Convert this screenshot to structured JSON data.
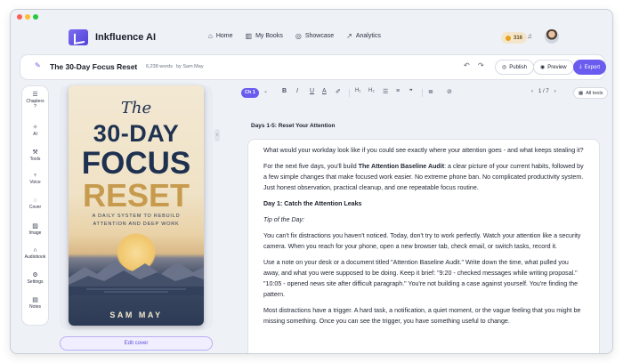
{
  "app": {
    "name": "Inkfluence AI",
    "nav": [
      {
        "label": "Home",
        "icon": "home-icon"
      },
      {
        "label": "My Books",
        "icon": "book-icon"
      },
      {
        "label": "Showcase",
        "icon": "globe-icon"
      },
      {
        "label": "Analytics",
        "icon": "chart-icon"
      }
    ],
    "credits": "316"
  },
  "header": {
    "title": "The 30-Day Focus Reset",
    "word_count": "6,238 words",
    "author": "by Sam May",
    "publish_label": "Publish",
    "preview_label": "Preview",
    "export_label": "Export"
  },
  "sidebar": {
    "items": [
      {
        "label": "Chapters",
        "icon": "list-icon"
      },
      {
        "label": "AI",
        "icon": "sparkle-icon"
      },
      {
        "label": "Tools",
        "icon": "wrench-icon"
      },
      {
        "label": "Voice",
        "icon": "microphone-icon"
      },
      {
        "label": "Cover",
        "icon": "palette-icon"
      },
      {
        "label": "Image",
        "icon": "image-icon"
      },
      {
        "label": "Audiobook",
        "icon": "headphones-icon"
      },
      {
        "label": "Settings",
        "icon": "gear-icon"
      },
      {
        "label": "Notes",
        "icon": "note-icon"
      }
    ],
    "help": "?"
  },
  "cover": {
    "line1": "The",
    "line2": "30-DAY",
    "line3": "FOCUS",
    "line4": "RESET",
    "subtitle1": "A DAILY SYSTEM TO REBUILD",
    "subtitle2": "ATTENTION AND DEEP WORK",
    "author": "SAM MAY",
    "edit_label": "Edit cover"
  },
  "editor": {
    "chapter_badge": "Ch 1",
    "page_indicator": "1 / 7",
    "all_tools_label": "All tools",
    "section_title": "Days 1-5: Reset Your Attention",
    "p1": "What would your workday look like if you could see exactly where your attention goes - and what keeps stealing it?",
    "p2_pre": "For the next five days, you'll build ",
    "p2_bold": "The Attention Baseline Audit",
    "p2_post": ": a clear picture of your current habits, followed by a few simple changes that make focused work easier. No extreme phone ban. No complicated productivity system. Just honest observation, practical cleanup, and one repeatable focus routine.",
    "h1": "Day 1: Catch the Attention Leaks",
    "tip": "Tip of the Day:",
    "p3": "You can't fix distractions you haven't noticed. Today, don't try to work perfectly. Watch your attention like a security camera. When you reach for your phone, open a new browser tab, check email, or switch tasks, record it.",
    "p4": "Use a note on your desk or a document titled \"Attention Baseline Audit.\" Write down the time, what pulled you away, and what you were supposed to be doing. Keep it brief: \"9:20 - checked messages while writing proposal.\" \"10:05 - opened news site after difficult paragraph.\" You're not building a case against yourself. You're finding the pattern.",
    "p5": "Most distractions have a trigger. A hard task, a notification, a quiet moment, or the vague feeling that you might be missing something. Once you can see the trigger, you have something useful to change."
  },
  "colors": {
    "accent": "#6b5cf0",
    "cover_navy": "#1e3150",
    "cover_gold": "#c79b4e"
  }
}
